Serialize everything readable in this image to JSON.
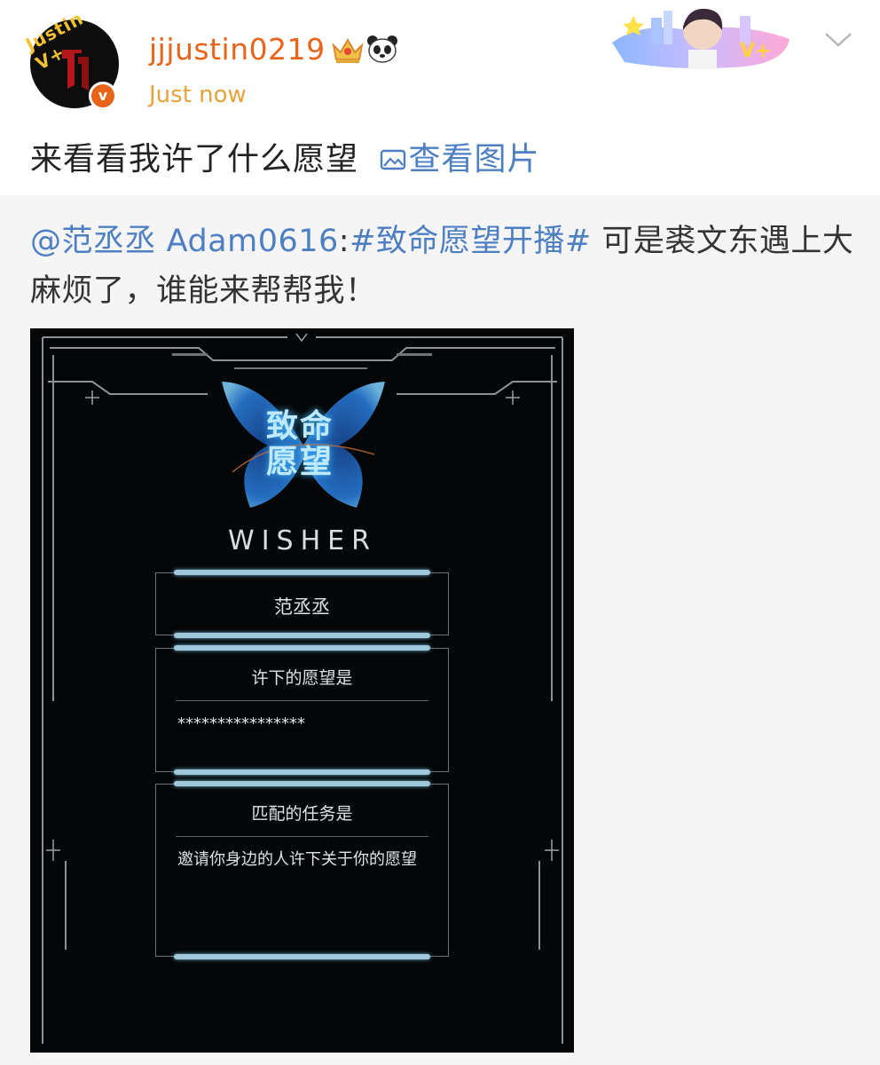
{
  "post": {
    "avatar_badge_text": "Justin V+",
    "username": "jjjustin0219",
    "timestamp": "Just now",
    "text": "来看看我许了什么愿望",
    "view_image_label": "查看图片",
    "icons": [
      "crown-icon",
      "panda-icon",
      "chevron-down-icon",
      "image-icon",
      "verified-badge-icon"
    ],
    "colors": {
      "username": "#e8641b",
      "timestamp": "#e8a23b",
      "link": "#4d7fc2"
    }
  },
  "repost": {
    "mention": "@范丞丞 Adam0616",
    "colon": ":",
    "hashtag": "#致命愿望开播#",
    "text": " 可是裘文东遇上大麻烦了，谁能来帮帮我！"
  },
  "game": {
    "title": "致命愿望",
    "subtitle": "WISHER",
    "name_value": "范丞丞",
    "wish_label": "许下的愿望是",
    "wish_value": "****************",
    "task_label": "匹配的任务是",
    "task_value": "邀请你身边的人许下关于你的愿望"
  }
}
